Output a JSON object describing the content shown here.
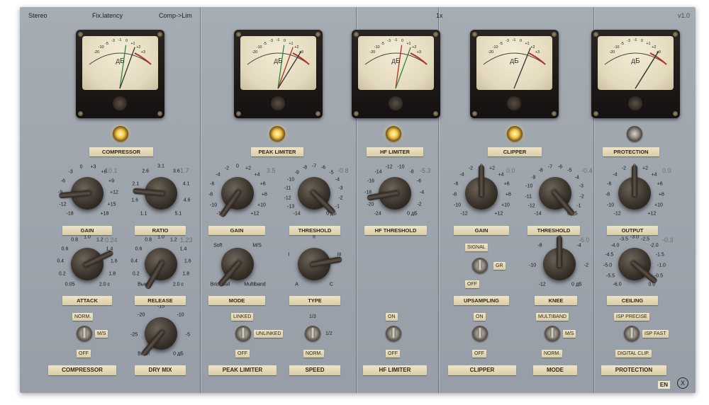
{
  "header": {
    "stereo": "Stereo",
    "latency": "Fix.latency",
    "mode": "Comp->Lim",
    "oversampling": "1x",
    "version": "v1.0"
  },
  "meters": [
    {
      "scale": [
        "-20",
        "-10",
        "-5",
        "-3",
        "-1",
        "0",
        "+1",
        "+2",
        "+3"
      ],
      "db": "дБ"
    },
    {
      "scale": [
        "-20",
        "-10",
        "-5",
        "-3",
        "-1",
        "0",
        "+1",
        "+2",
        "+3"
      ],
      "db": "дБ"
    },
    {
      "scale": [
        "-20",
        "-10",
        "-5",
        "-3",
        "-1",
        "0",
        "+1",
        "+2",
        "+3"
      ],
      "db": "дБ"
    },
    {
      "scale": [
        "-20",
        "-10",
        "-5",
        "-3",
        "-1",
        "0",
        "+1",
        "+2",
        "+3"
      ],
      "db": "дБ"
    },
    {
      "scale": [
        "-20",
        "-10",
        "-5",
        "-3",
        "-1",
        "0",
        "+1",
        "+2",
        "+3"
      ],
      "db": "дБ"
    }
  ],
  "sections": [
    {
      "label": "COMPRESSOR",
      "lamp": "on"
    },
    {
      "label": "PEAK LIMITER",
      "lamp": "on"
    },
    {
      "label": "HF LIMITER",
      "lamp": "on"
    },
    {
      "label": "CLIPPER",
      "lamp": "on"
    },
    {
      "label": "PROTECTION",
      "lamp": "off"
    }
  ],
  "knobs": [
    {
      "label": "GAIN",
      "value": "10.1",
      "ticks": [
        "-18",
        "-12",
        "-9",
        "-6",
        "-3",
        "0",
        "+3",
        "+6",
        "+9",
        "+12",
        "+15",
        "+18"
      ],
      "unit": "",
      "angle": -95
    },
    {
      "label": "RATIO",
      "value": "1.7",
      "ticks": [
        "1.1",
        "1.6",
        "2.1",
        "2.6",
        "3.1",
        "3.6",
        "4.1",
        "4.6",
        "5.1"
      ],
      "unit": "",
      "angle": -85
    },
    {
      "label": "ATTACK",
      "value": "0.24",
      "ticks": [
        "0.05",
        "0.2",
        "0.4",
        "0.6",
        "0.8",
        "1.0",
        "1.2",
        "1.4",
        "1.6",
        "1.8",
        "2.0 c"
      ],
      "unit": "",
      "angle": 65
    },
    {
      "label": "RELEASE",
      "value": "1.23",
      "ticks": [
        "Выкл",
        "0.2",
        "0.4",
        "0.6",
        "0.8",
        "1.0",
        "1.2",
        "1.4",
        "1.6",
        "1.8",
        "2.0 c"
      ],
      "unit": "",
      "angle": -150
    },
    {
      "label": "DRY MIX",
      "value": "",
      "ticks": [
        "Выкл",
        "-25",
        "-20",
        "-15",
        "-10",
        "-5",
        "0 дБ"
      ],
      "unit": "",
      "angle": -140
    },
    {
      "label": "GAIN",
      "value": "3.5",
      "ticks": [
        "-12",
        "-10",
        "-8",
        "-6",
        "-4",
        "-2",
        "0",
        "+2",
        "+4",
        "+6",
        "+8",
        "+10",
        "+12"
      ],
      "unit": "",
      "angle": -145
    },
    {
      "label": "THRESHOLD",
      "value": "-0.8",
      "ticks": [
        "-14",
        "-13",
        "-12",
        "-11",
        "-10",
        "-9",
        "-8",
        "-7",
        "-6",
        "-5",
        "-4",
        "-3",
        "-2",
        "-1",
        "0 дБ"
      ],
      "unit": "",
      "angle": 135
    },
    {
      "label": "MODE",
      "value": "",
      "ticks": [
        "Brickwall",
        "Soft",
        "M/S",
        "Multiband"
      ],
      "unit": "",
      "angle": -140
    },
    {
      "label": "TYPE",
      "value": "",
      "ticks": [
        "A",
        "I",
        "II",
        "III",
        "C"
      ],
      "unit": "",
      "angle": 80
    },
    {
      "label": "HF THRESHOLD",
      "value": "-5.3",
      "ticks": [
        "-24",
        "-20",
        "-18",
        "-16",
        "-14",
        "-12",
        "-10",
        "-8",
        "-6",
        "-4",
        "-2",
        "0 дБ"
      ],
      "unit": "",
      "angle": -100
    },
    {
      "label": "GAIN",
      "value": "0.0",
      "ticks": [
        "-12",
        "-10",
        "-8",
        "-6",
        "-4",
        "-2",
        "0",
        "+2",
        "+4",
        "+6",
        "+8",
        "+10",
        "+12"
      ],
      "unit": "",
      "angle": 0
    },
    {
      "label": "THRESHOLD",
      "value": "-0.4",
      "ticks": [
        "-14",
        "-12",
        "-11",
        "-10",
        "-9",
        "-8",
        "-7",
        "-6",
        "-5",
        "-4",
        "-3",
        "-2",
        "-1",
        "0 дБ"
      ],
      "unit": "",
      "angle": 140
    },
    {
      "label": "KNEE",
      "value": "-6.0",
      "ticks": [
        "-12",
        "-10",
        "-8",
        "-6",
        "-4",
        "-2",
        "0 дБ"
      ],
      "unit": "",
      "angle": 0
    },
    {
      "label": "OUTPUT",
      "value": "0.0",
      "ticks": [
        "-12",
        "-10",
        "-8",
        "-6",
        "-4",
        "-2",
        "0",
        "+2",
        "+4",
        "+6",
        "+8",
        "+10",
        "+12"
      ],
      "unit": "",
      "angle": 0
    },
    {
      "label": "CEILING",
      "value": "-0.3",
      "ticks": [
        "-6.0",
        "-5.5",
        "-5.0",
        "-4.5",
        "-4.0",
        "-3.5",
        "-3.0",
        "-2.5",
        "-2.0",
        "-1.5",
        "-1.0",
        "-0.5",
        "0.0"
      ],
      "unit": "",
      "angle": 130
    }
  ],
  "switches": {
    "comp": {
      "top": "NORM.",
      "side": "M/S",
      "bottom": "OFF",
      "label": "COMPRESSOR"
    },
    "drymix_label": "DRY MIX",
    "peak": {
      "top": "LINKED",
      "side": "UNLINKED",
      "bottom": "OFF",
      "label": "PEAK LIMITER"
    },
    "speed": {
      "top": "1/3",
      "side": "1/2",
      "bottom": "NORM.",
      "label": "SPEED"
    },
    "hf": {
      "top": "ON",
      "bottom": "OFF",
      "label": "HF LIMITER"
    },
    "ups": {
      "top": "SIGNAL",
      "side": "GR",
      "bottom": "OFF",
      "label": "UPSAMPLING"
    },
    "clip": {
      "top": "ON",
      "bottom": "OFF",
      "label": "CLIPPER"
    },
    "cmode": {
      "top": "MULTIBAND",
      "side": "M/S",
      "bottom": "NORM.",
      "label": "MODE"
    },
    "prot": {
      "top": "ISP PRECISE",
      "side": "ISP FAST",
      "bottom": "DIGITAL CLIP.",
      "label": "PROTECTION"
    }
  },
  "footer": {
    "lang": "EN",
    "logo": "X"
  }
}
